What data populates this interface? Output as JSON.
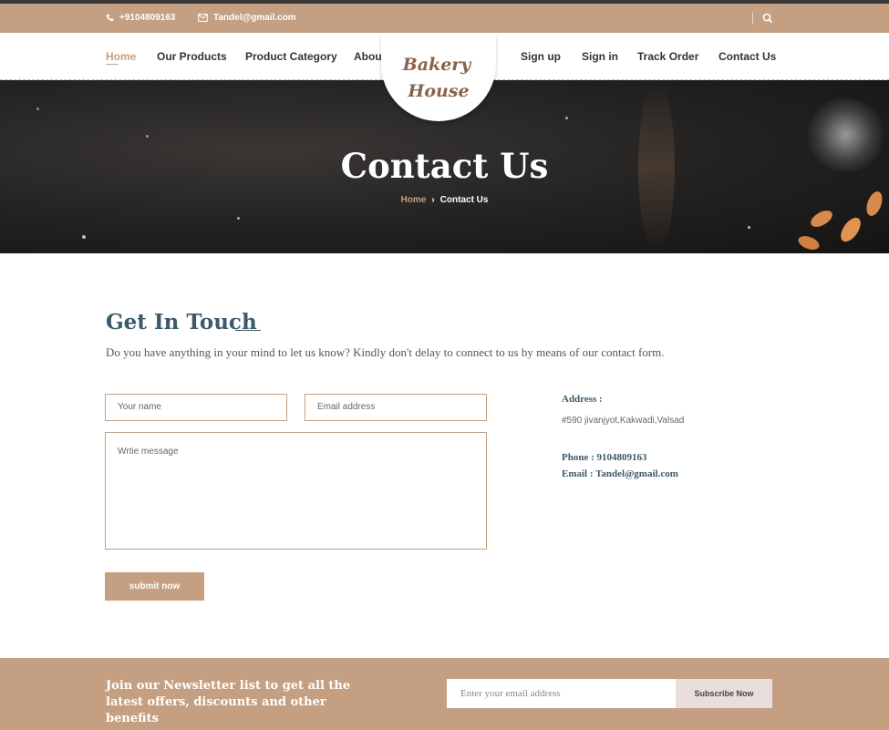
{
  "topbar": {
    "phone": "+9104809163",
    "email": "Tandel@gmail.com",
    "icons": [
      "phone-icon",
      "envelope-icon",
      "search-icon"
    ],
    "bg_color": "#c49f81"
  },
  "nav": {
    "left": [
      "Home",
      "Our Products",
      "Product Category",
      "About Us"
    ],
    "right": [
      "Sign up",
      "Sign in",
      "Track Order",
      "Contact Us"
    ],
    "active": "Home"
  },
  "logo": {
    "line1": "Bakery",
    "line2": "House"
  },
  "hero": {
    "title": "Contact Us",
    "breadcrumb": {
      "home": "Home",
      "separator": "›",
      "current": "Contact Us"
    }
  },
  "contact": {
    "heading": "Get In Touch",
    "intro": "Do you have anything in your mind to let us know? Kindly don't delay to connect to us by means of our contact form.",
    "form": {
      "name_placeholder": "Your name",
      "email_placeholder": "Email address",
      "message_placeholder": "Wrtie message",
      "submit_label": "submit now"
    },
    "info": {
      "address_label": "Address :",
      "address": "#590 jivanjyot,Kakwadi,Valsad",
      "phone": "Phone : 9104809163",
      "email": "Email : Tandel@gmail.com"
    }
  },
  "newsletter": {
    "text": "Join our Newsletter list to get all the latest offers, discounts and other benefits",
    "placeholder": "Enter your email address",
    "button_label": "Subscribe Now"
  },
  "colors": {
    "accent": "#c49f81",
    "heading": "#3d5a6a",
    "hero_bg": "#222120"
  }
}
